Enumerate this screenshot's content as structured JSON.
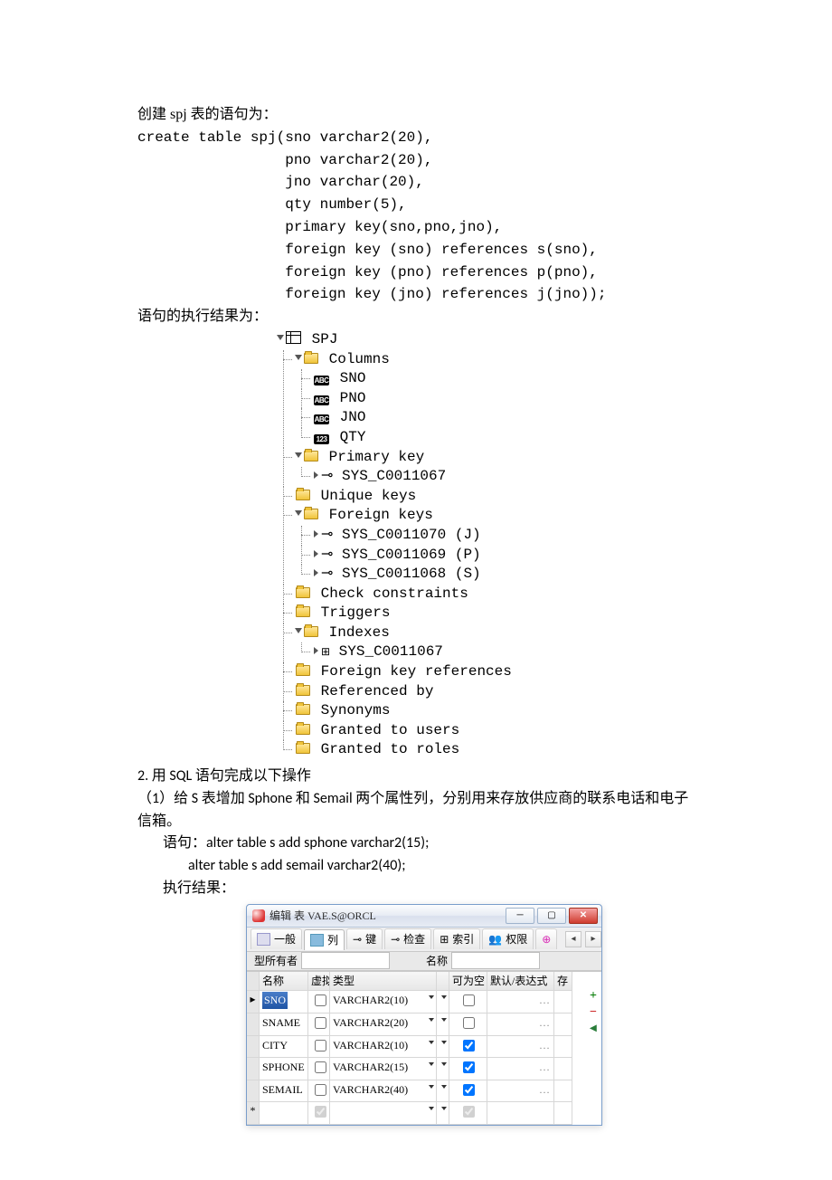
{
  "text": {
    "l1": "创建 spj 表的语句为：",
    "code1": "create table spj(sno varchar2(20),",
    "code2": "                 pno varchar2(20),",
    "code3": "                 jno varchar(20),",
    "code4": "                 qty number(5),",
    "code5": "                 primary key(sno,pno,jno),",
    "code6": "                 foreign key (sno) references s(sno),",
    "code7": "                 foreign key (pno) references p(pno),",
    "code8": "                 foreign key (jno) references j(jno));",
    "l2": "语句的执行结果为：",
    "q2_num": "2.",
    "q2_txt": " 用 SQL 语句完成以下操作",
    "q2a": "（1）给 S 表增加 Sphone 和 Semail 两个属性列，分别用来存放供应商的联系电话和电子信箱。",
    "stmt_lbl": "语句：",
    "stmt1": "alter table s add sphone varchar2(15);",
    "stmt2": "alter table s add semail varchar2(40);",
    "res_lbl": "执行结果："
  },
  "tree": {
    "root": "SPJ",
    "columns_folder": "Columns",
    "columns": [
      "SNO",
      "PNO",
      "JNO",
      "QTY"
    ],
    "pk_folder": "Primary key",
    "pk": "SYS_C0011067",
    "uk_folder": "Unique keys",
    "fk_folder": "Foreign keys",
    "fk1": "SYS_C0011070  (J)",
    "fk2": "SYS_C0011069  (P)",
    "fk3": "SYS_C0011068  (S)",
    "cc_folder": "Check constraints",
    "trg_folder": "Triggers",
    "idx_folder": "Indexes",
    "idx1": "SYS_C0011067",
    "fkr_folder": "Foreign key references",
    "rb_folder": "Referenced by",
    "syn_folder": "Synonyms",
    "gu_folder": "Granted to users",
    "gr_folder": "Granted to roles"
  },
  "win": {
    "title": "编辑 表 VAE.S@ORCL",
    "tabs": {
      "general": "一般",
      "columns": "列",
      "keys": "键",
      "check": "检查",
      "index": "索引",
      "priv": "权限"
    },
    "owner_label": "型所有者",
    "name_label": "名称",
    "headers": {
      "name": "名称",
      "virtual": "虚拟",
      "type": "类型",
      "nullable": "可为空",
      "default": "默认/表达式",
      "storage": "存"
    },
    "rows": [
      {
        "name": "SNO",
        "type": "VARCHAR2(10)",
        "null": false
      },
      {
        "name": "SNAME",
        "type": "VARCHAR2(20)",
        "null": false
      },
      {
        "name": "CITY",
        "type": "VARCHAR2(10)",
        "null": true
      },
      {
        "name": "SPHONE",
        "type": "VARCHAR2(15)",
        "null": true
      },
      {
        "name": "SEMAIL",
        "type": "VARCHAR2(40)",
        "null": true
      }
    ]
  }
}
